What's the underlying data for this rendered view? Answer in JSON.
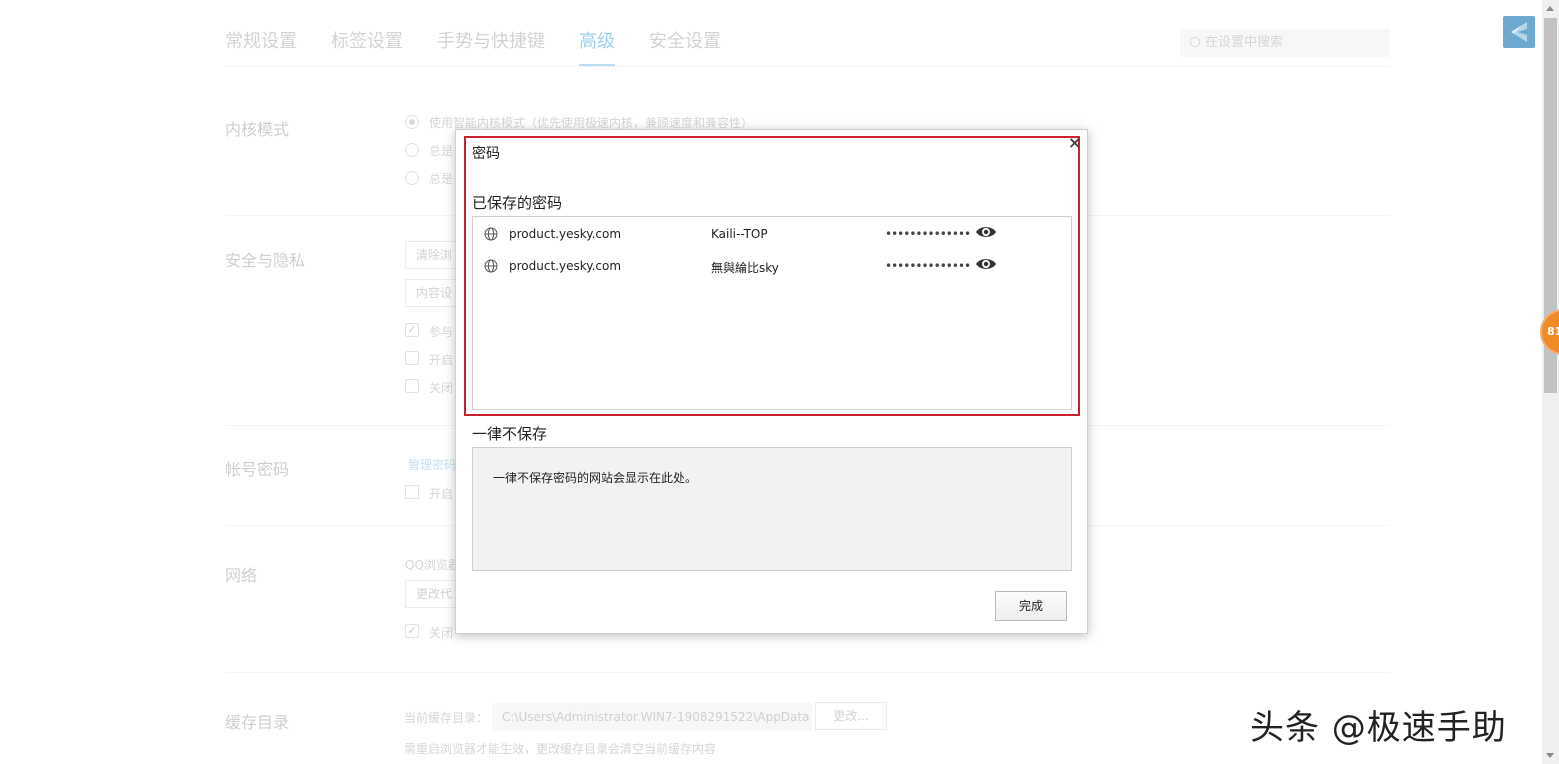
{
  "settings": {
    "tabs": [
      "常规设置",
      "标签设置",
      "手势与快捷键",
      "高级",
      "安全设置"
    ],
    "active_tab": "高级",
    "search_placeholder": "在设置中搜索",
    "sections": {
      "kernel": {
        "label": "内核模式",
        "options": [
          "使用智能内核模式（优先使用极速内核，兼顾速度和兼容性）",
          "总是",
          "总是"
        ]
      },
      "security": {
        "label": "安全与隐私",
        "buttons": [
          "清除浏",
          "内容设"
        ],
        "checks": [
          "参与",
          "开启",
          "关闭"
        ]
      },
      "account": {
        "label": "帐号密码",
        "link": "管理密码",
        "check": "开启"
      },
      "network": {
        "label": "网络",
        "note": "QQ浏览器",
        "button": "更改代",
        "check": "关闭"
      },
      "cache": {
        "label": "缓存目录",
        "current_label": "当前缓存目录：",
        "path": "C:\\Users\\Administrator.WIN7-1908291522\\AppData",
        "change_button": "更改...",
        "note": "需重启浏览器才能生效，更改缓存目录会清空当前缓存内容"
      }
    }
  },
  "float_badge": "81",
  "watermark": "头条 @极速手助",
  "dialog": {
    "title": "密码",
    "close_glyph": "×",
    "saved_heading": "已保存的密码",
    "saved_passwords": [
      {
        "site": "product.yesky.com",
        "username": "Kaili--TOP",
        "password_mask": "••••••••••••••"
      },
      {
        "site": "product.yesky.com",
        "username": "無與綸比sky",
        "password_mask": "••••••••••••••"
      }
    ],
    "never_heading": "一律不保存",
    "never_empty_text": "一律不保存密码的网站会显示在此处。",
    "done_label": "完成"
  },
  "colors": {
    "highlight_frame": "#c8232c",
    "active_tab": "#9dd0ee"
  }
}
